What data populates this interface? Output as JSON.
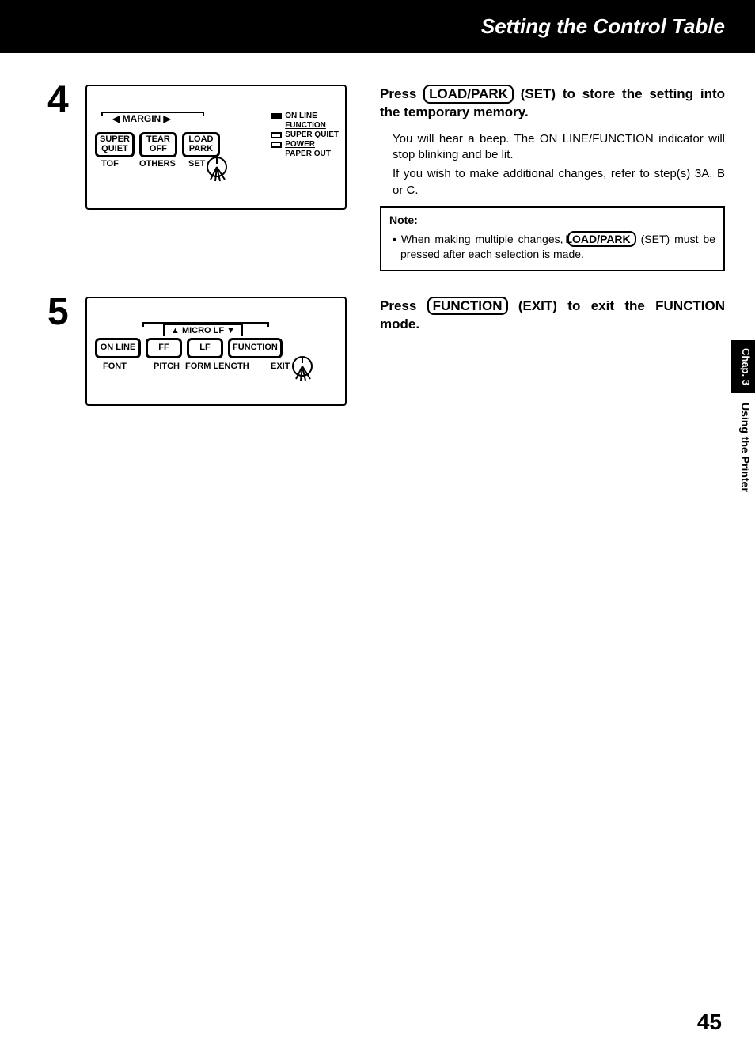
{
  "header": {
    "title": "Setting the Control Table"
  },
  "step4": {
    "number": "4",
    "panel": {
      "margin_label": "◀ MARGIN ▶",
      "buttons": [
        {
          "line1": "SUPER",
          "line2": "QUIET"
        },
        {
          "line1": "TEAR",
          "line2": "OFF"
        },
        {
          "line1": "LOAD",
          "line2": "PARK"
        }
      ],
      "sublabels": [
        "TOF",
        "OTHERS",
        "SET"
      ],
      "indicators": {
        "online": "ON LINE",
        "function": "FUNCTION",
        "superquiet": "SUPER QUIET",
        "power": "POWER",
        "paperout": "PAPER OUT"
      }
    },
    "instruction": {
      "pre": "Press ",
      "key": "LOAD/PARK",
      "post": " (SET) to store the setting into the temporary memory."
    },
    "body1": "You will hear a beep. The ON LINE/FUNCTION indicator will stop blinking and be lit.",
    "body2": "If you wish to make additional changes, refer to step(s) 3A, B or C.",
    "note": {
      "title": "Note:",
      "bullet_pre": "• When making multiple changes, ",
      "bullet_key": "LOAD/PARK",
      "bullet_post": " (SET) must be pressed after each selection is made."
    }
  },
  "step5": {
    "number": "5",
    "panel": {
      "microlf_label": "▲ MICRO LF ▼",
      "buttons": [
        "ON LINE",
        "FF",
        "LF",
        "FUNCTION"
      ],
      "sublabels": [
        "FONT",
        "PITCH",
        "FORM LENGTH",
        "EXIT"
      ]
    },
    "instruction": {
      "pre": "Press ",
      "key": "FUNCTION",
      "post": " (EXIT) to exit the FUNCTION mode."
    }
  },
  "side": {
    "chapter": "Chap. 3",
    "section": "Using the Printer"
  },
  "page_number": "45"
}
